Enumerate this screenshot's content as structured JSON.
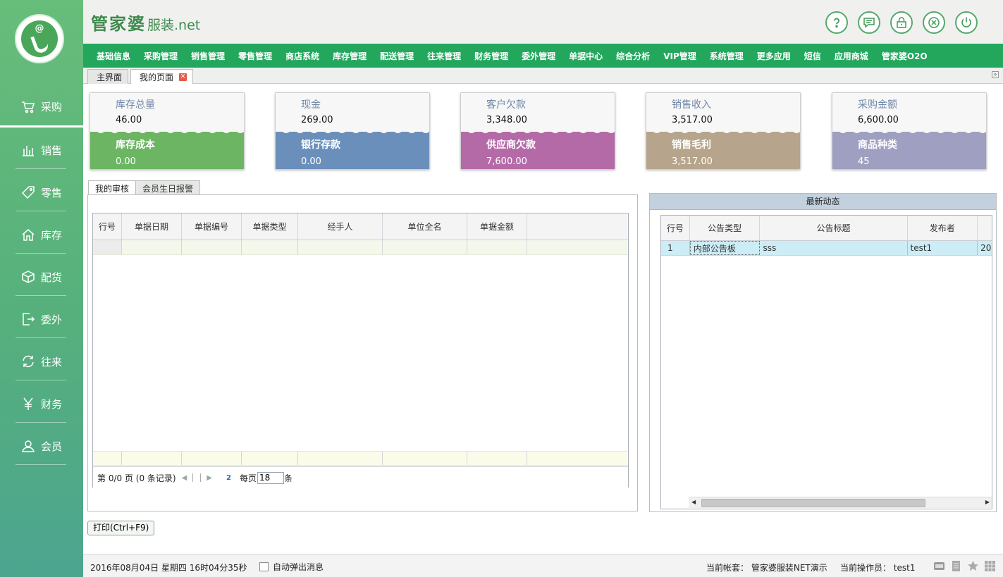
{
  "brand": {
    "name": "管家婆",
    "sub": "服装",
    "suffix": ".net",
    "logo_text": "@"
  },
  "sidebar": {
    "items": [
      {
        "label": "采购",
        "icon": "cart-icon"
      },
      {
        "label": "销售",
        "icon": "bar-chart-icon"
      },
      {
        "label": "零售",
        "icon": "tag-icon"
      },
      {
        "label": "库存",
        "icon": "home-icon"
      },
      {
        "label": "配货",
        "icon": "box-icon"
      },
      {
        "label": "委外",
        "icon": "export-icon"
      },
      {
        "label": "往来",
        "icon": "refresh-icon"
      },
      {
        "label": "财务",
        "icon": "yen-icon"
      },
      {
        "label": "会员",
        "icon": "user-icon"
      }
    ],
    "active_index": 0
  },
  "toolbar_icons": [
    "help-icon",
    "message-icon",
    "lock-icon",
    "close-circle-icon",
    "power-icon"
  ],
  "menu": [
    "基础信息",
    "采购管理",
    "销售管理",
    "零售管理",
    "商店系统",
    "库存管理",
    "配送管理",
    "往来管理",
    "财务管理",
    "委外管理",
    "单据中心",
    "综合分析",
    "VIP管理",
    "系统管理",
    "更多应用",
    "短信",
    "应用商城",
    "管家婆O2O"
  ],
  "page_tabs": {
    "home": "主界面",
    "mine": "我的页面"
  },
  "cards": [
    {
      "top_label": "库存总量",
      "top_value": "46.00",
      "bottom_label": "库存成本",
      "bottom_value": "0.00",
      "color": "#6cb563"
    },
    {
      "top_label": "现金",
      "top_value": "269.00",
      "bottom_label": "银行存款",
      "bottom_value": "0.00",
      "color": "#6b8fbb"
    },
    {
      "top_label": "客户欠款",
      "top_value": "3,348.00",
      "bottom_label": "供应商欠款",
      "bottom_value": "7,600.00",
      "color": "#b56aa8"
    },
    {
      "top_label": "销售收入",
      "top_value": "3,517.00",
      "bottom_label": "销售毛利",
      "bottom_value": "3,517.00",
      "color": "#b6a58c"
    },
    {
      "top_label": "采购金额",
      "top_value": "6,600.00",
      "bottom_label": "商品种类",
      "bottom_value": "45",
      "color": "#9f9fc1"
    }
  ],
  "sub_tabs": {
    "audit": "我的审核",
    "birthday": "会员生日报警"
  },
  "audit_grid": {
    "columns": [
      "行号",
      "单据日期",
      "单据编号",
      "单据类型",
      "经手人",
      "单位全名",
      "单据金额"
    ],
    "pager": {
      "page_info": "第 0/0 页 (0 条记录)",
      "per_page_label": "每页",
      "per_page_value": "18",
      "unit": "条",
      "refresh": "2"
    }
  },
  "news": {
    "title": "最新动态",
    "columns": [
      "行号",
      "公告类型",
      "公告标题",
      "发布者"
    ],
    "rows": [
      {
        "no": "1",
        "type": "内部公告板",
        "title": "sss",
        "publisher": "test1",
        "extra": "20"
      }
    ]
  },
  "print_button": "打印(Ctrl+F9)",
  "status": {
    "datetime": "2016年08月04日 星期四 16时04分35秒",
    "auto_popup": "自动弹出消息",
    "account_label": "当前帐套：",
    "account_value": "管家婆服装NET演示",
    "operator_label": "当前操作员：",
    "operator_value": "test1"
  }
}
